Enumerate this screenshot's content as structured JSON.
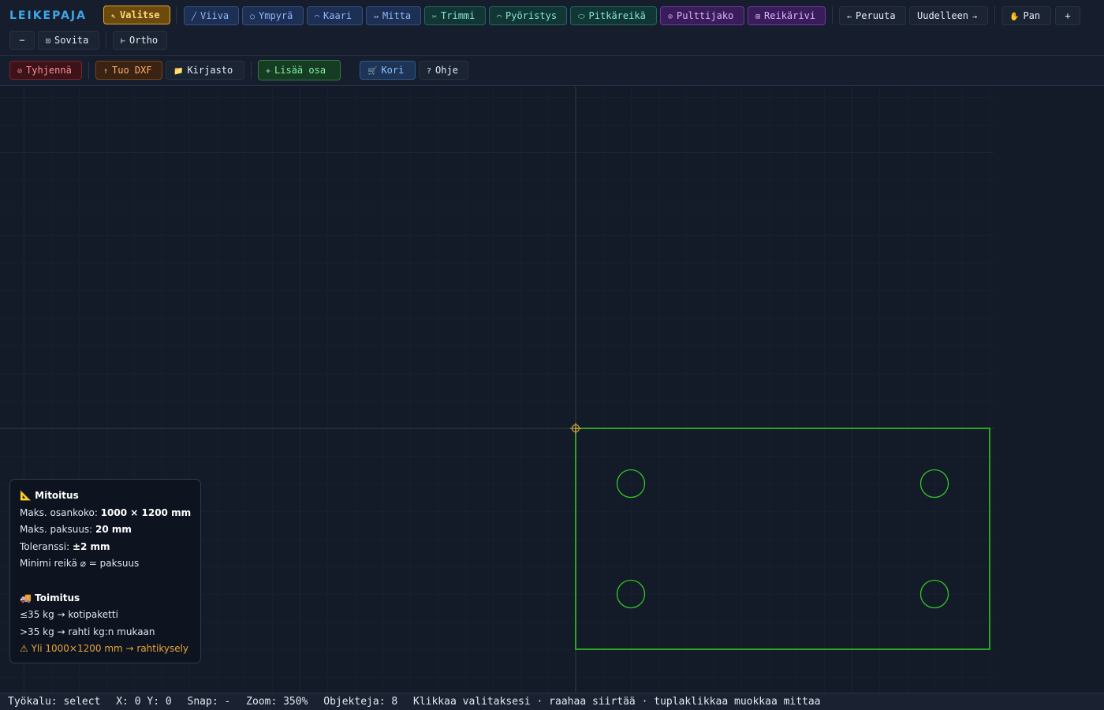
{
  "app": {
    "brand": "LEIKEPAJA"
  },
  "toolbar": {
    "tools": [
      {
        "icon": "↖",
        "label": "Valitse",
        "style": "active",
        "icon_name": "cursor-arrow-icon"
      },
      {
        "icon": "╱",
        "label": "Viiva",
        "style": "blue",
        "icon_name": "line-icon"
      },
      {
        "icon": "○",
        "label": "Ympyrä",
        "style": "blue",
        "icon_name": "circle-icon"
      },
      {
        "icon": "⌒",
        "label": "Kaari",
        "style": "blue",
        "icon_name": "arc-icon"
      },
      {
        "icon": "↔",
        "label": "Mitta",
        "style": "blue",
        "icon_name": "dimension-icon"
      },
      {
        "icon": "✂",
        "label": "Trimmi",
        "style": "teal",
        "icon_name": "scissors-icon"
      },
      {
        "icon": "⌒",
        "label": "Pyöristys",
        "style": "teal",
        "icon_name": "fillet-icon"
      },
      {
        "icon": "⬭",
        "label": "Pitkäreikä",
        "style": "teal",
        "icon_name": "slot-icon"
      },
      {
        "icon": "⊙",
        "label": "Pulttijako",
        "style": "purple",
        "icon_name": "bolt-circle-icon"
      },
      {
        "icon": "⊞",
        "label": "Reikärivi",
        "style": "purple",
        "icon_name": "hole-row-icon"
      }
    ],
    "undo": {
      "icon": "←",
      "label": "Peruuta"
    },
    "redo": {
      "icon": "→",
      "label": "Uudelleen"
    },
    "pan": {
      "icon": "✋",
      "label": "Pan"
    },
    "zoom_in": "+",
    "zoom_out": "−",
    "fit": {
      "icon": "⊡",
      "label": "Sovita"
    },
    "ortho": {
      "icon": "⊢",
      "label": "Ortho"
    }
  },
  "toolbar2": {
    "clear": {
      "icon": "⊘",
      "label": "Tyhjennä"
    },
    "import": {
      "icon": "↑",
      "label": "Tuo DXF"
    },
    "library": {
      "icon": "📁",
      "label": "Kirjasto"
    },
    "add_part": {
      "icon": "+",
      "label": "Lisää osa"
    },
    "cart": {
      "icon": "🛒",
      "label": "Kori"
    },
    "help": {
      "icon": "?",
      "label": "Ohje"
    }
  },
  "info": {
    "dim_heading": "Mitoitus",
    "dim_icon": "📐",
    "max_size_label": "Maks. osankoko:",
    "max_size_value": "1000 × 1200 mm",
    "max_thickness_label": "Maks. paksuus:",
    "max_thickness_value": "20 mm",
    "tolerance_label": "Toleranssi:",
    "tolerance_value": "±2 mm",
    "min_hole": "Minimi reikä ⌀ = paksuus",
    "delivery_heading": "Toimitus",
    "delivery_icon": "🚚",
    "rule1": "≤35 kg → kotipaketti",
    "rule2": ">35 kg → rahti kg:n mukaan",
    "warning": "⚠ Yli 1000×1200 mm → rahtikysely"
  },
  "status": {
    "tool": "Työkalu: select",
    "coords": "X: 0 Y: 0",
    "snap": "Snap: -",
    "zoom": "Zoom: 350%",
    "objects": "Objekteja: 8",
    "hint": "Klikkaa valitaksesi · raahaa siirtää · tuplaklikkaa muokkaa mittaa"
  },
  "colors": {
    "accent": "#3fa6e8",
    "part_outline": "#35c424",
    "origin_marker": "#d2a23a",
    "warning": "#e8a43a"
  }
}
